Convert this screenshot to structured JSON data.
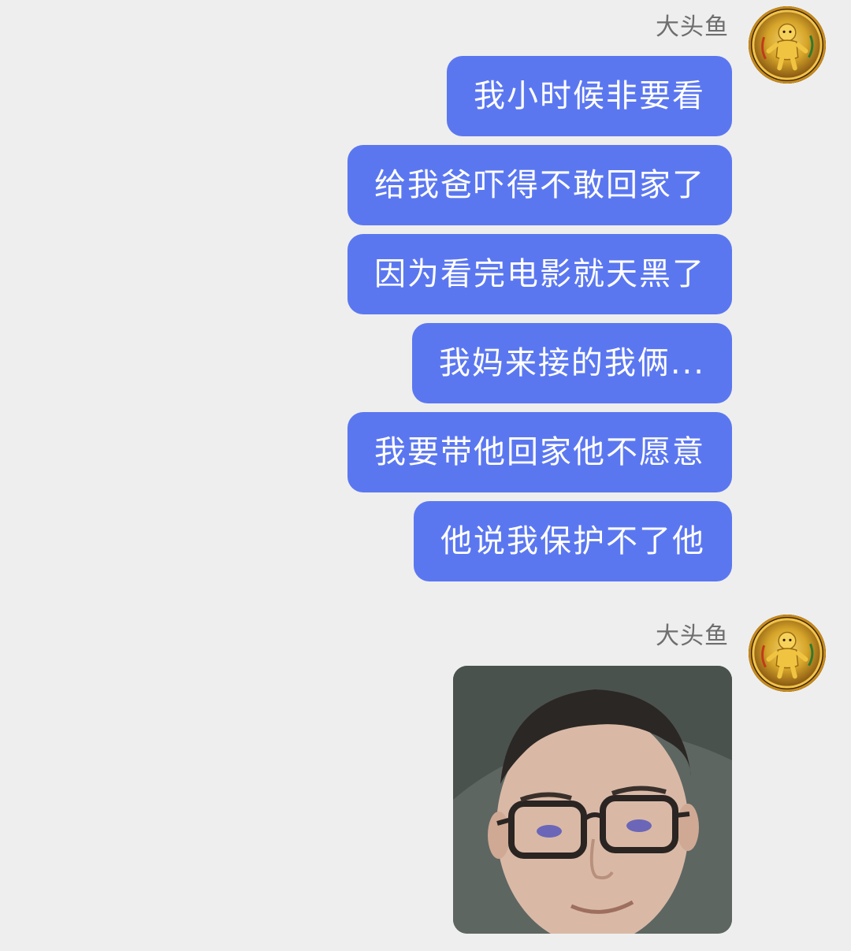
{
  "conversation": {
    "groups": [
      {
        "sender": "大头鱼",
        "messages": [
          "我小时候非要看",
          "给我爸吓得不敢回家了",
          "因为看完电影就天黑了",
          "我妈来接的我俩...",
          "我要带他回家他不愿意",
          "他说我保护不了他"
        ]
      },
      {
        "sender": "大头鱼",
        "image": "face-photo-sticker"
      }
    ]
  },
  "colors": {
    "background": "#eeeeee",
    "bubble": "#5b77f0",
    "bubble_text": "#ffffff",
    "sender_name": "#6e6e6e"
  },
  "icons": {
    "avatar": "golden-gingerbread-avatar-icon"
  }
}
